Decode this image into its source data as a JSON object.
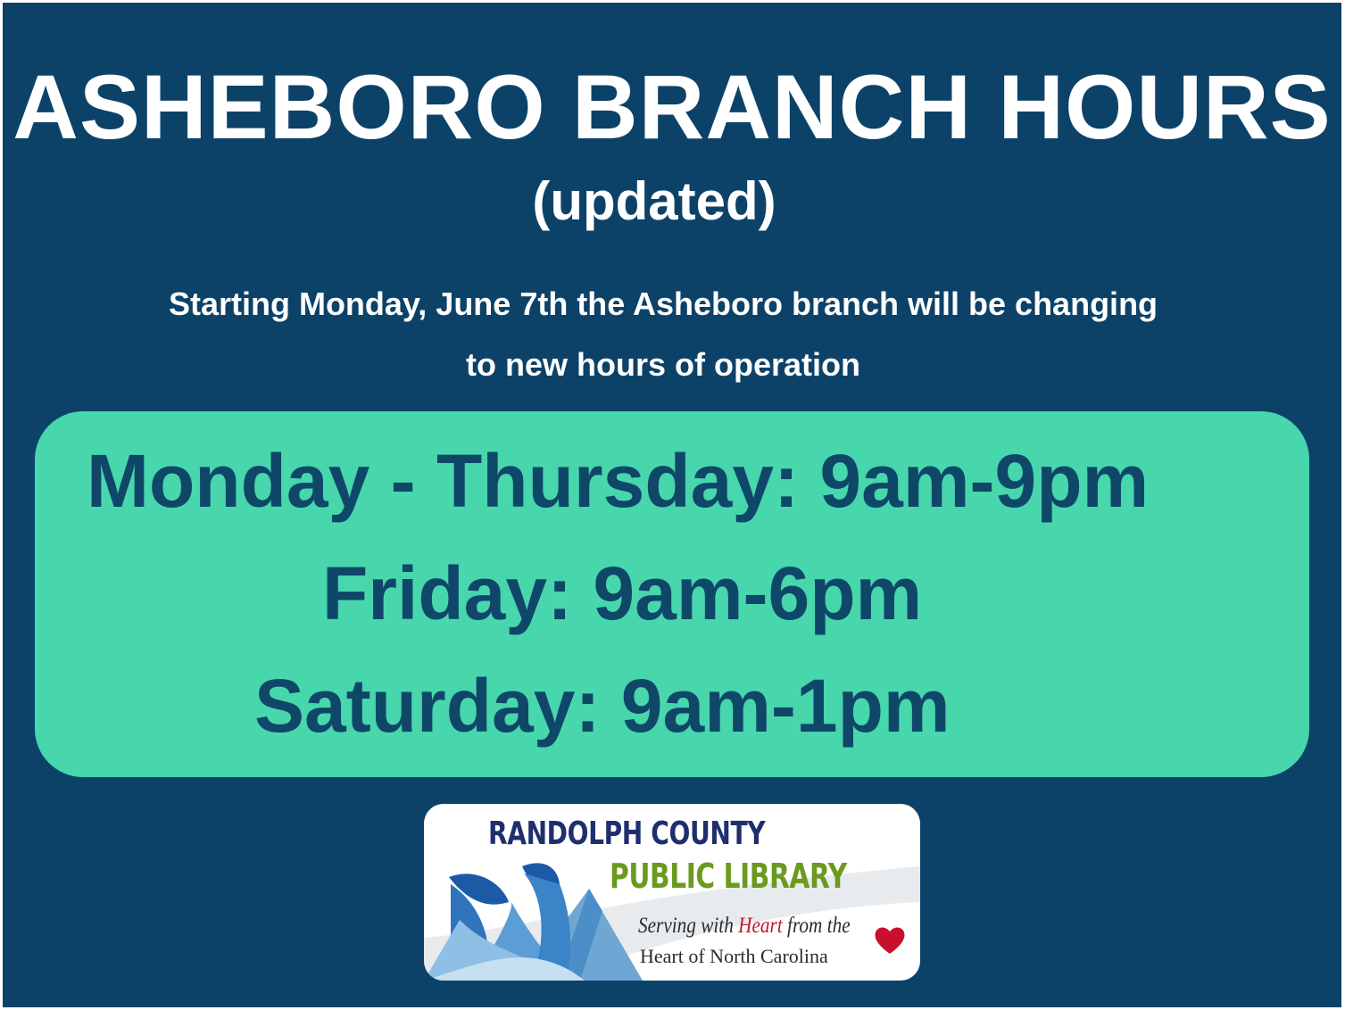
{
  "title": "ASHEBORO BRANCH HOURS",
  "subtitle": "(updated)",
  "notice": {
    "line1": "Starting Monday, June 7th the Asheboro branch will be changing",
    "line2": "to new hours of operation"
  },
  "hours": [
    "Monday - Thursday: 9am-9pm",
    "Friday: 9am-6pm",
    "Saturday: 9am-1pm"
  ],
  "logo": {
    "line1": "RANDOLPH COUNTY",
    "line2": "PUBLIC LIBRARY",
    "tagline_part1": "Serving with ",
    "tagline_heart": "Heart",
    "tagline_part2": " from the",
    "tagline_line2": "Heart of North Carolina"
  },
  "colors": {
    "background": "#0d4268",
    "hours_box": "#48d6ad",
    "hours_text": "#0f4768",
    "logo_navy": "#1f2f6e",
    "logo_green": "#6a9a1f",
    "logo_red": "#c0172b"
  },
  "icons": {
    "logo_mark": "mountain-wave-logo",
    "heart": "heart-icon"
  }
}
